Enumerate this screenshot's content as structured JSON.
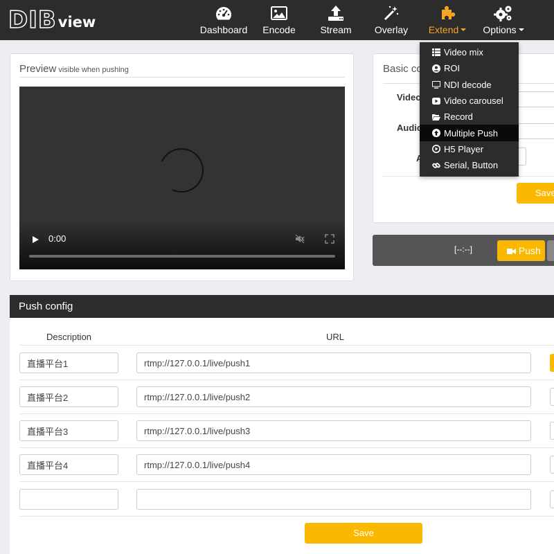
{
  "logo": {
    "big": "DIB",
    "small": "view"
  },
  "nav": [
    {
      "label": "Dashboard",
      "icon": "dashboard-icon"
    },
    {
      "label": "Encode",
      "icon": "image-icon"
    },
    {
      "label": "Stream",
      "icon": "upload-icon"
    },
    {
      "label": "Overlay",
      "icon": "magic-wand-icon"
    },
    {
      "label": "Extend",
      "icon": "puzzle-icon",
      "active": true,
      "has_caret": true
    },
    {
      "label": "Options",
      "icon": "gears-icon",
      "has_caret": true
    }
  ],
  "extend_menu": [
    {
      "label": "Video mix",
      "icon": "list-icon"
    },
    {
      "label": "ROI",
      "icon": "user-circle-icon"
    },
    {
      "label": "NDI decode",
      "icon": "monitor-icon"
    },
    {
      "label": "Video carousel",
      "icon": "youtube-icon"
    },
    {
      "label": "Record",
      "icon": "folder-open-icon"
    },
    {
      "label": "Multiple Push",
      "icon": "arrow-circle-up-icon",
      "selected": true
    },
    {
      "label": "H5 Player",
      "icon": "play-circle-icon"
    },
    {
      "label": "Serial, Button",
      "icon": "link-icon"
    }
  ],
  "preview": {
    "title": "Preview",
    "subtitle": "visible when pushing",
    "time": "0:00"
  },
  "basic": {
    "title": "Basic co",
    "video_label": "Video",
    "audio_label": "Audio",
    "a_label": "A",
    "save": "Save"
  },
  "pushbar": {
    "timer": "[--:--]",
    "push": "Push"
  },
  "push_config": {
    "title": "Push config",
    "col_description": "Description",
    "col_url": "URL",
    "rows": [
      {
        "description": "直播平台1",
        "url": "rtmp://127.0.0.1/live/push1"
      },
      {
        "description": "直播平台2",
        "url": "rtmp://127.0.0.1/live/push2"
      },
      {
        "description": "直播平台3",
        "url": "rtmp://127.0.0.1/live/push3"
      },
      {
        "description": "直播平台4",
        "url": "rtmp://127.0.0.1/live/push4"
      },
      {
        "description": "",
        "url": ""
      }
    ],
    "save": "Save"
  },
  "colors": {
    "accent": "#fbb800",
    "nav_active": "#f5a623",
    "topbar": "#2c2c2c"
  }
}
